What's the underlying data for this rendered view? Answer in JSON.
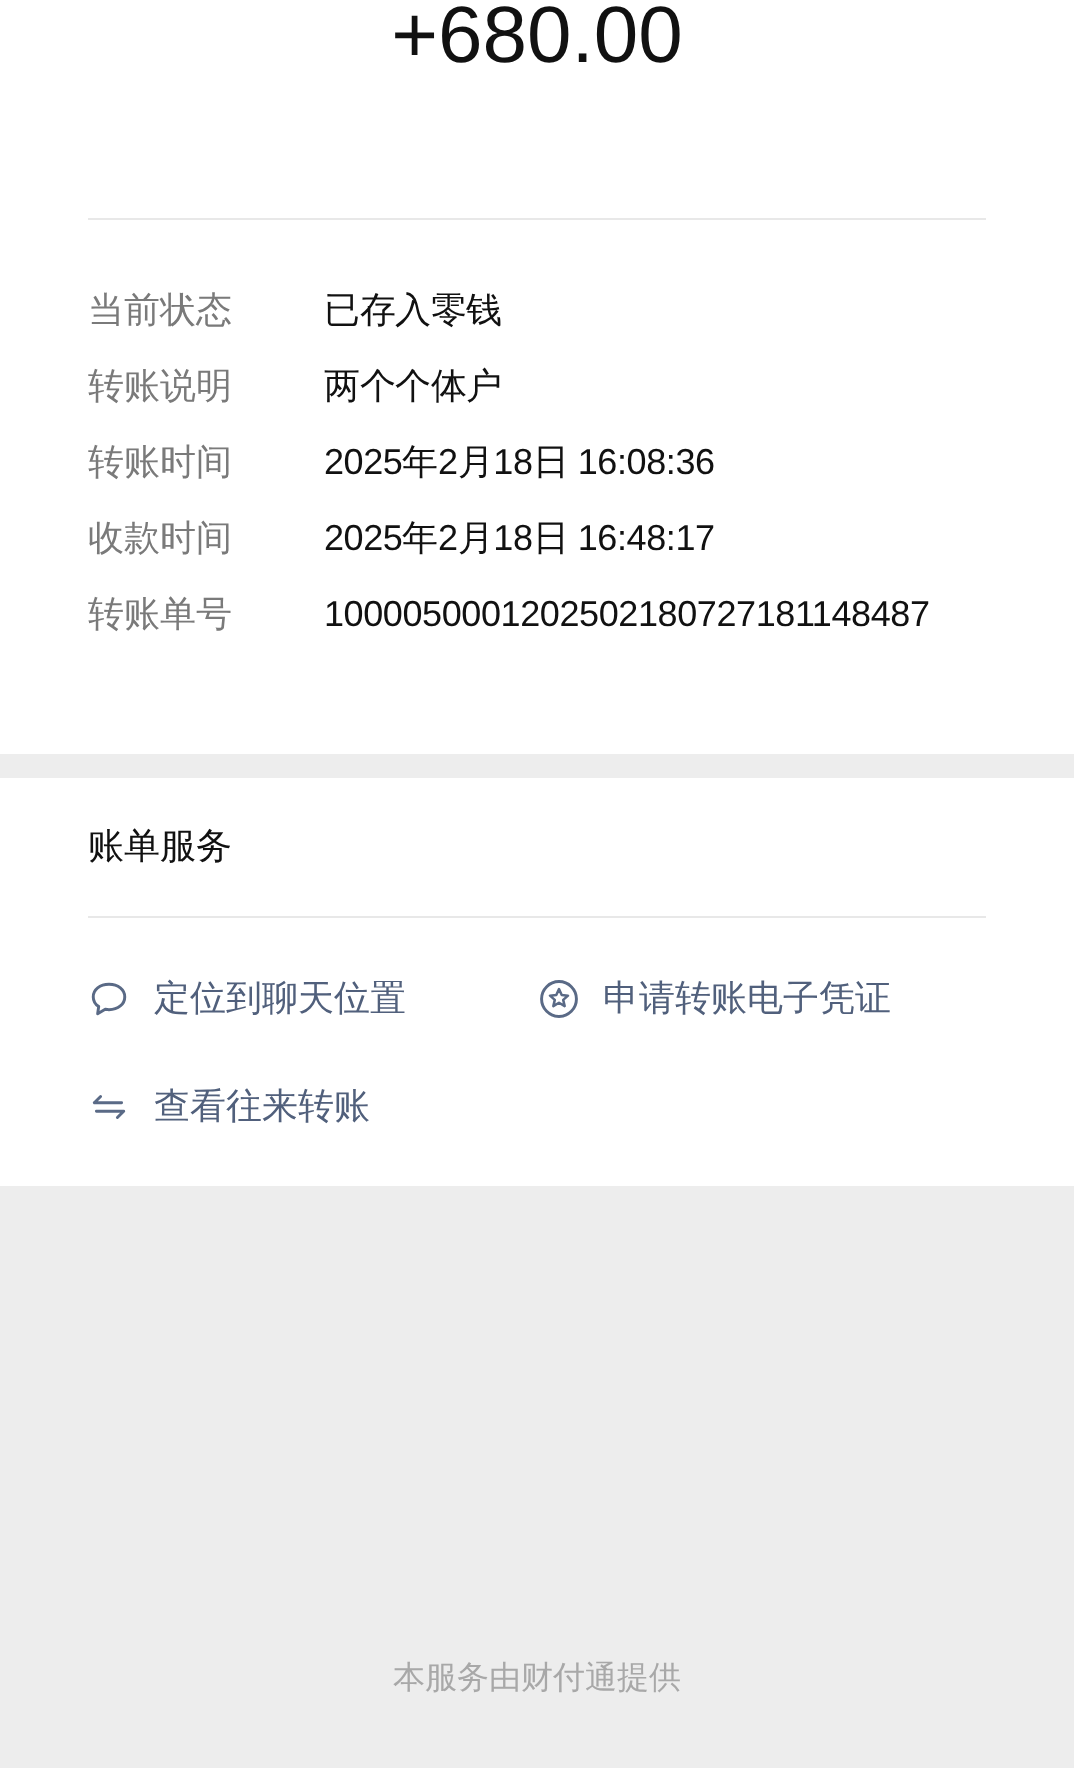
{
  "amount": "+680.00",
  "details": [
    {
      "label": "当前状态",
      "value": "已存入零钱"
    },
    {
      "label": "转账说明",
      "value": "两个个体户"
    },
    {
      "label": "转账时间",
      "value": "2025年2月18日 16:08:36"
    },
    {
      "label": "收款时间",
      "value": "2025年2月18日 16:48:17"
    },
    {
      "label": "转账单号",
      "value": "1000050001202502180727181148487"
    }
  ],
  "services": {
    "title": "账单服务",
    "actions": [
      {
        "kind": "chat",
        "label": "定位到聊天位置"
      },
      {
        "kind": "star",
        "label": "申请转账电子凭证"
      },
      {
        "kind": "swap",
        "label": "查看往来转账"
      }
    ]
  },
  "footer": "本服务由财付通提供"
}
